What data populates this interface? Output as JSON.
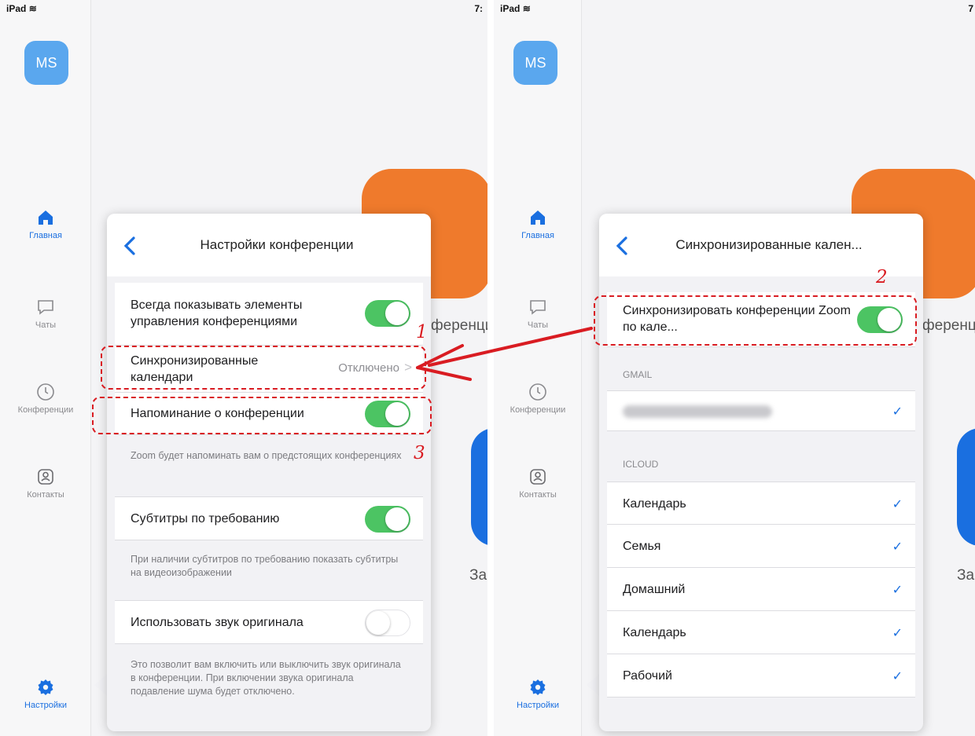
{
  "left": {
    "status": {
      "device": "iPad",
      "time": "7:"
    },
    "avatar": "MS",
    "nav": {
      "home": "Главная",
      "chats": "Чаты",
      "meetings": "Конференции",
      "contacts": "Контакты",
      "settings": "Настройки"
    },
    "background": {
      "meetings_text": "ференци",
      "start_text": "За"
    },
    "panel": {
      "title": "Настройки конференции",
      "rows": [
        {
          "label": "Всегда показывать элементы управления конференциями",
          "toggle": true
        },
        {
          "label": "Синхронизированные календари",
          "value": "Отключено",
          "chevron": ">"
        },
        {
          "label": "Напоминание о конференции",
          "toggle": true
        },
        {
          "label": "Субтитры по требованию",
          "toggle": true
        },
        {
          "label": "Использовать звук оригинала",
          "toggle": false
        }
      ],
      "notes": [
        "Zoom будет напоминать вам о предстоящих конференциях",
        "При наличии субтитров по требованию показать субтитры на видеоизображении",
        "Это позволит вам включить или выключить звук оригинала в конференции. При включении звука оригинала подавление шума будет отключено."
      ]
    },
    "markers": [
      "1",
      "3"
    ]
  },
  "right": {
    "status": {
      "device": "iPad",
      "time": "7"
    },
    "avatar": "MS",
    "nav": {
      "home": "Главная",
      "chats": "Чаты",
      "meetings": "Конференции",
      "contacts": "Контакты",
      "settings": "Настройки"
    },
    "background": {
      "meetings_text": "ференц",
      "start_text": "За"
    },
    "panel": {
      "title": "Синхронизированные кален...",
      "sync_label": "Синхронизировать конференции Zoom по кале...",
      "sync_toggle": true,
      "sections": [
        {
          "header": "GMAIL",
          "items": [
            {
              "label": "",
              "checked": true,
              "blurred": true
            }
          ]
        },
        {
          "header": "ICLOUD",
          "items": [
            {
              "label": "Календарь",
              "checked": true
            },
            {
              "label": "Семья",
              "checked": true
            },
            {
              "label": "Домашний",
              "checked": true
            },
            {
              "label": "Календарь",
              "checked": true
            },
            {
              "label": "Рабочий",
              "checked": true
            }
          ]
        }
      ],
      "check_glyph": "✓"
    },
    "markers": [
      "2"
    ]
  },
  "colors": {
    "accent": "#1a6fe0",
    "toggle_on": "#4cc463",
    "annotation": "#d91c22",
    "zoom_orange": "#ef7a2c"
  }
}
